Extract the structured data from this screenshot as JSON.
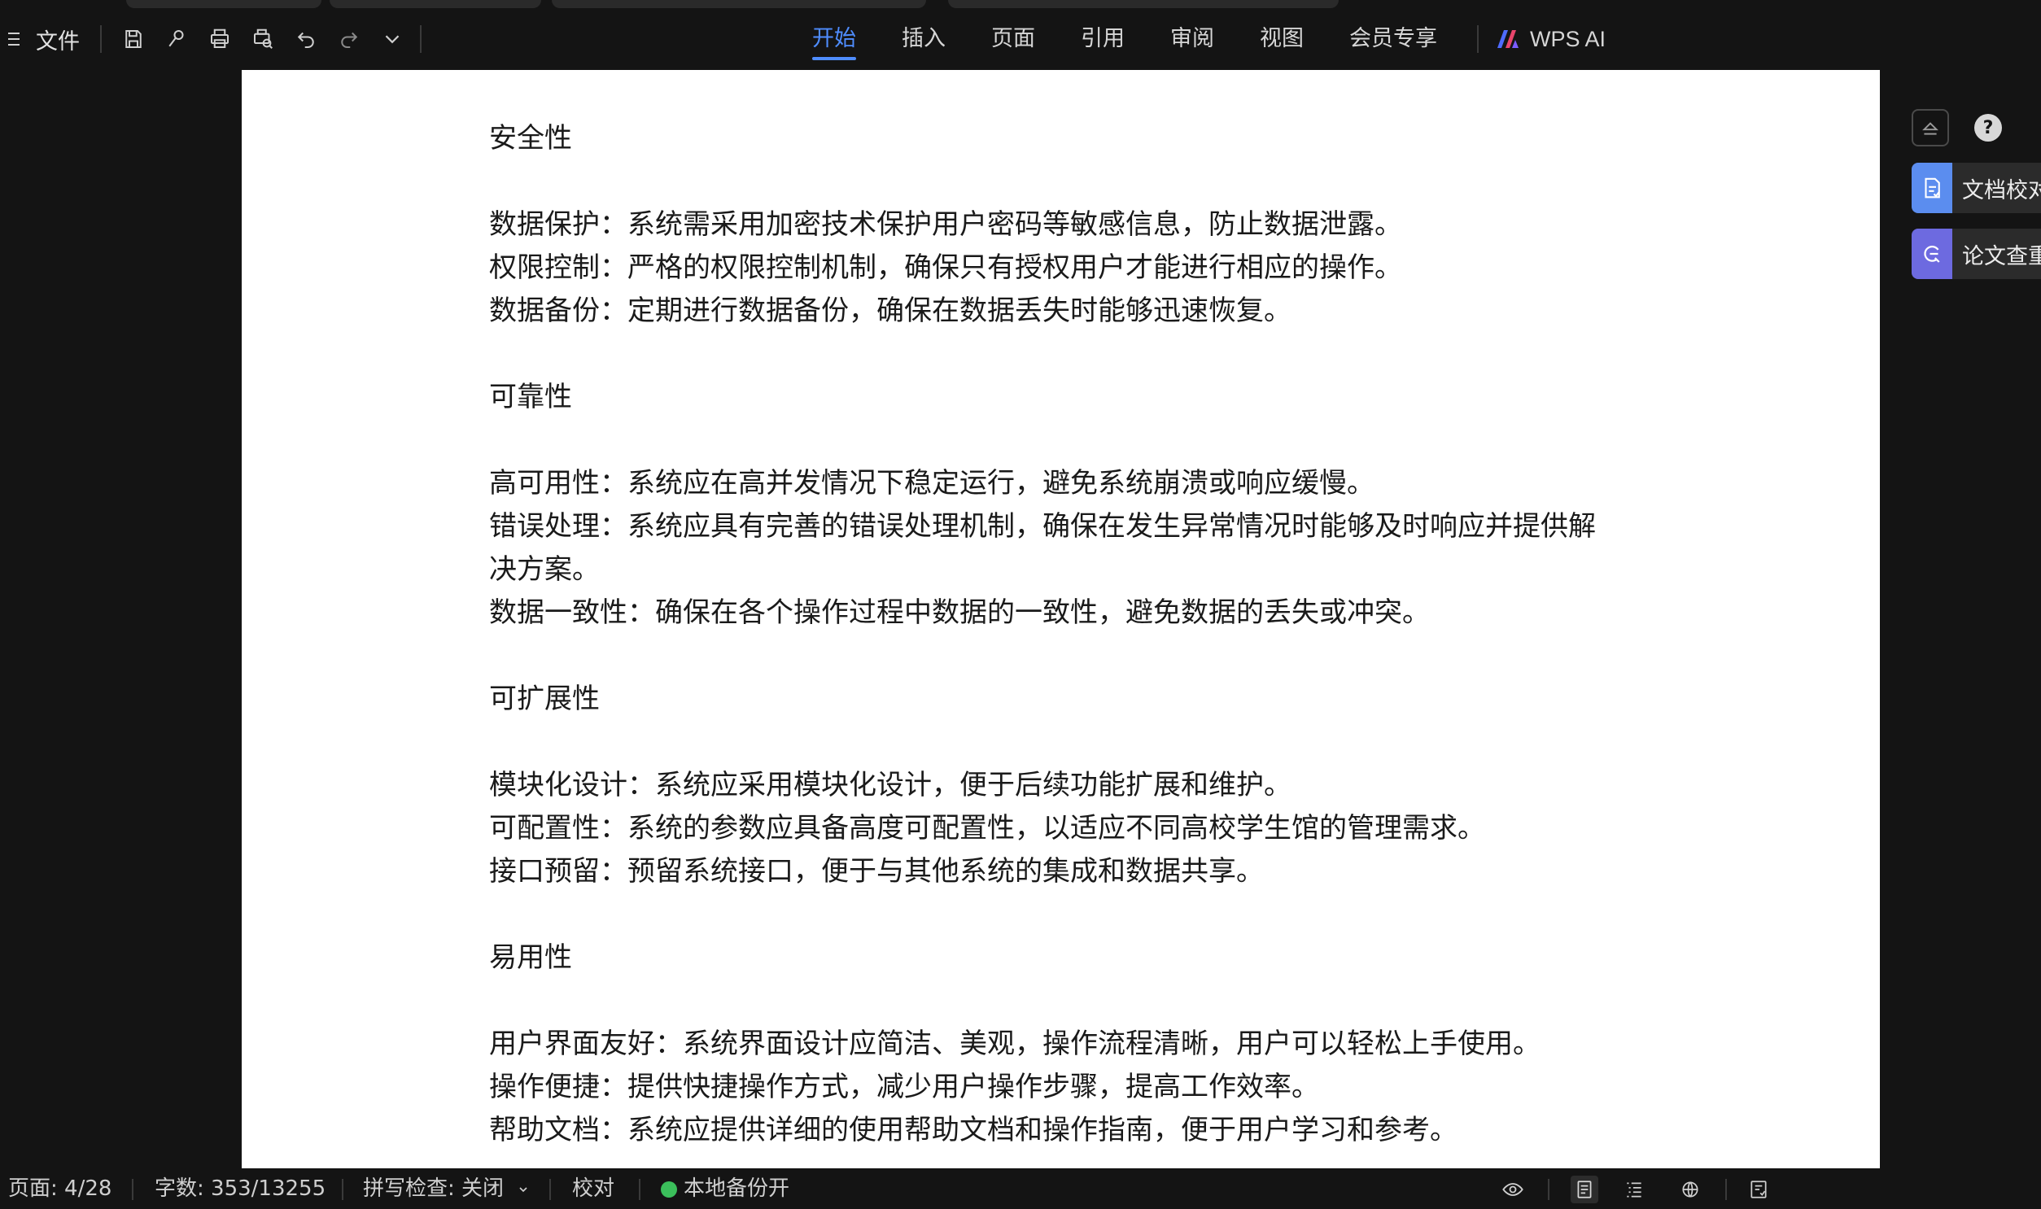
{
  "menu": {
    "file_label": "文件"
  },
  "ribbon": {
    "tabs": [
      {
        "label": "开始",
        "active": true
      },
      {
        "label": "插入"
      },
      {
        "label": "页面"
      },
      {
        "label": "引用"
      },
      {
        "label": "审阅"
      },
      {
        "label": "视图"
      },
      {
        "label": "会员专享"
      }
    ],
    "ai_label": "WPS AI"
  },
  "quick_tools": [
    "save-icon",
    "format-painter-icon",
    "print-icon",
    "print-preview-icon",
    "undo-icon",
    "redo-icon",
    "more-chevron-icon"
  ],
  "document": {
    "lines": [
      "安全性",
      "",
      "数据保护：系统需采用加密技术保护用户密码等敏感信息，防止数据泄露。",
      "权限控制：严格的权限控制机制，确保只有授权用户才能进行相应的操作。",
      "数据备份：定期进行数据备份，确保在数据丢失时能够迅速恢复。",
      "",
      "可靠性",
      "",
      "高可用性：系统应在高并发情况下稳定运行，避免系统崩溃或响应缓慢。",
      "错误处理：系统应具有完善的错误处理机制，确保在发生异常情况时能够及时响应并提供解",
      "决方案。",
      "数据一致性：确保在各个操作过程中数据的一致性，避免数据的丢失或冲突。",
      "",
      "可扩展性",
      "",
      "模块化设计：系统应采用模块化设计，便于后续功能扩展和维护。",
      "可配置性：系统的参数应具备高度可配置性，以适应不同高校学生馆的管理需求。",
      "接口预留：预留系统接口，便于与其他系统的集成和数据共享。",
      "",
      "易用性",
      "",
      "用户界面友好：系统界面设计应简洁、美观，操作流程清晰，用户可以轻松上手使用。",
      "操作便捷：提供快捷操作方式，减少用户操作步骤，提高工作效率。",
      "帮助文档：系统应提供详细的使用帮助文档和操作指南，便于用户学习和参考。"
    ]
  },
  "side_panel": {
    "cards": [
      {
        "label": "文档校对",
        "color": "#5b8def"
      },
      {
        "label": "论文查重",
        "color": "#6d6ae0"
      }
    ]
  },
  "status": {
    "page": "页面: 4/28",
    "words": "字数: 353/13255",
    "spell": "拼写检查: 关闭",
    "proof": "校对",
    "backup": "本地备份开"
  }
}
